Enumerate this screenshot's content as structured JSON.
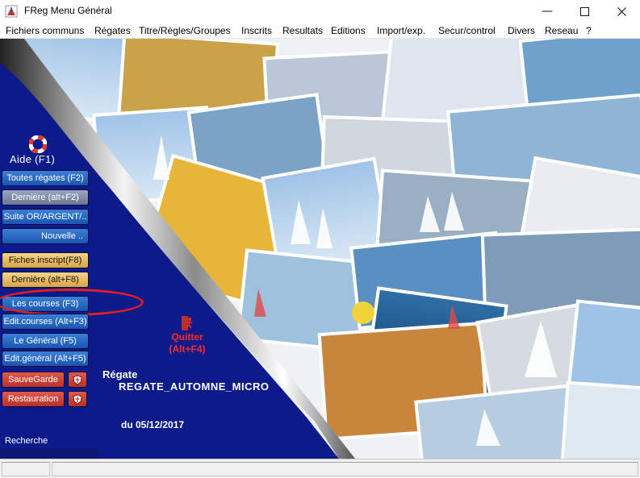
{
  "window": {
    "title": "FReg  Menu Général",
    "controls": [
      "minimize-icon",
      "maximize-icon",
      "close-icon"
    ]
  },
  "menu": {
    "items": [
      "Fichiers communs",
      "Régates",
      "Titre/Règles/Groupes",
      "Inscrits",
      "Resultats",
      "Editions",
      "Import/exp.",
      "Secur/control",
      "Divers",
      "Reseau",
      "?"
    ]
  },
  "panel": {
    "help_label": "Aide  (F1)",
    "buttons": [
      {
        "label": "Toutes régates (F2)",
        "style": "blue"
      },
      {
        "label": "Dernière  (alt+F2)",
        "style": "grey"
      },
      {
        "label": "Suite OR/ARGENT/..",
        "style": "blue"
      },
      {
        "label": "Nouvelle ..",
        "style": "blue"
      },
      {
        "label": "Fiches inscript(F8)",
        "style": "gold"
      },
      {
        "label": "Dernière (alt+F8)",
        "style": "gold"
      },
      {
        "label": "Les courses  (F3)",
        "style": "blue"
      },
      {
        "label": "Edit.courses  (Alt+F3)",
        "style": "blue"
      },
      {
        "label": "Le Général  (F5)",
        "style": "blue"
      },
      {
        "label": "Edit.général  (Alt+F5)",
        "style": "blue"
      },
      {
        "label": "SauveGarde",
        "style": "red"
      },
      {
        "label": "Restauration",
        "style": "red"
      }
    ],
    "quit_label_1": "Quitter",
    "quit_label_2": "(Alt+F4)",
    "regate_label": "Régate",
    "regate_name": "REGATE_AUTOMNE_MICRO",
    "regate_date": "du 05/12/2017",
    "search_label": "Recherche"
  },
  "colors": {
    "panel_blue": "#0d1a8a",
    "highlight_red": "#e02020",
    "quit_red": "#ff2a2a"
  }
}
